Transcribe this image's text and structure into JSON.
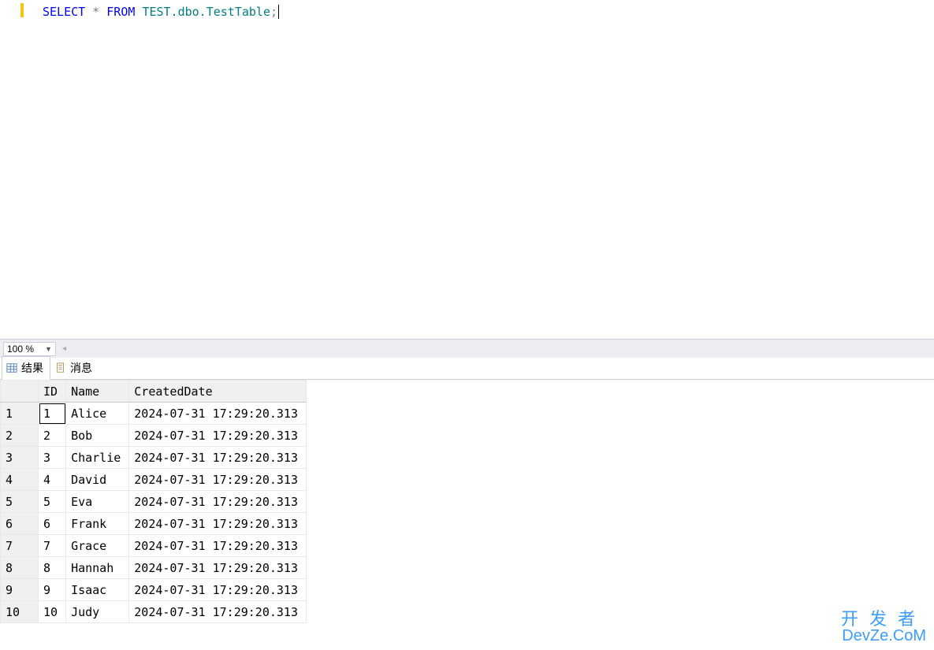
{
  "editor": {
    "sql_tokens": {
      "select": "SELECT",
      "star": "*",
      "from": "FROM",
      "table": "TEST.dbo.TestTable",
      "semicolon": ";"
    }
  },
  "zoom": {
    "value": "100 %"
  },
  "tabs": {
    "results": "结果",
    "messages": "消息"
  },
  "grid": {
    "headers": {
      "rownum": "",
      "id": "ID",
      "name": "Name",
      "created": "CreatedDate"
    },
    "rows": [
      {
        "n": "1",
        "id": "1",
        "name": "Alice",
        "created": "2024-07-31 17:29:20.313"
      },
      {
        "n": "2",
        "id": "2",
        "name": "Bob",
        "created": "2024-07-31 17:29:20.313"
      },
      {
        "n": "3",
        "id": "3",
        "name": "Charlie",
        "created": "2024-07-31 17:29:20.313"
      },
      {
        "n": "4",
        "id": "4",
        "name": "David",
        "created": "2024-07-31 17:29:20.313"
      },
      {
        "n": "5",
        "id": "5",
        "name": "Eva",
        "created": "2024-07-31 17:29:20.313"
      },
      {
        "n": "6",
        "id": "6",
        "name": "Frank",
        "created": "2024-07-31 17:29:20.313"
      },
      {
        "n": "7",
        "id": "7",
        "name": "Grace",
        "created": "2024-07-31 17:29:20.313"
      },
      {
        "n": "8",
        "id": "8",
        "name": "Hannah",
        "created": "2024-07-31 17:29:20.313"
      },
      {
        "n": "9",
        "id": "9",
        "name": "Isaac",
        "created": "2024-07-31 17:29:20.313"
      },
      {
        "n": "10",
        "id": "10",
        "name": "Judy",
        "created": "2024-07-31 17:29:20.313"
      }
    ]
  },
  "watermark": {
    "line1": "开发者",
    "line2": "DevZe.CoM"
  }
}
